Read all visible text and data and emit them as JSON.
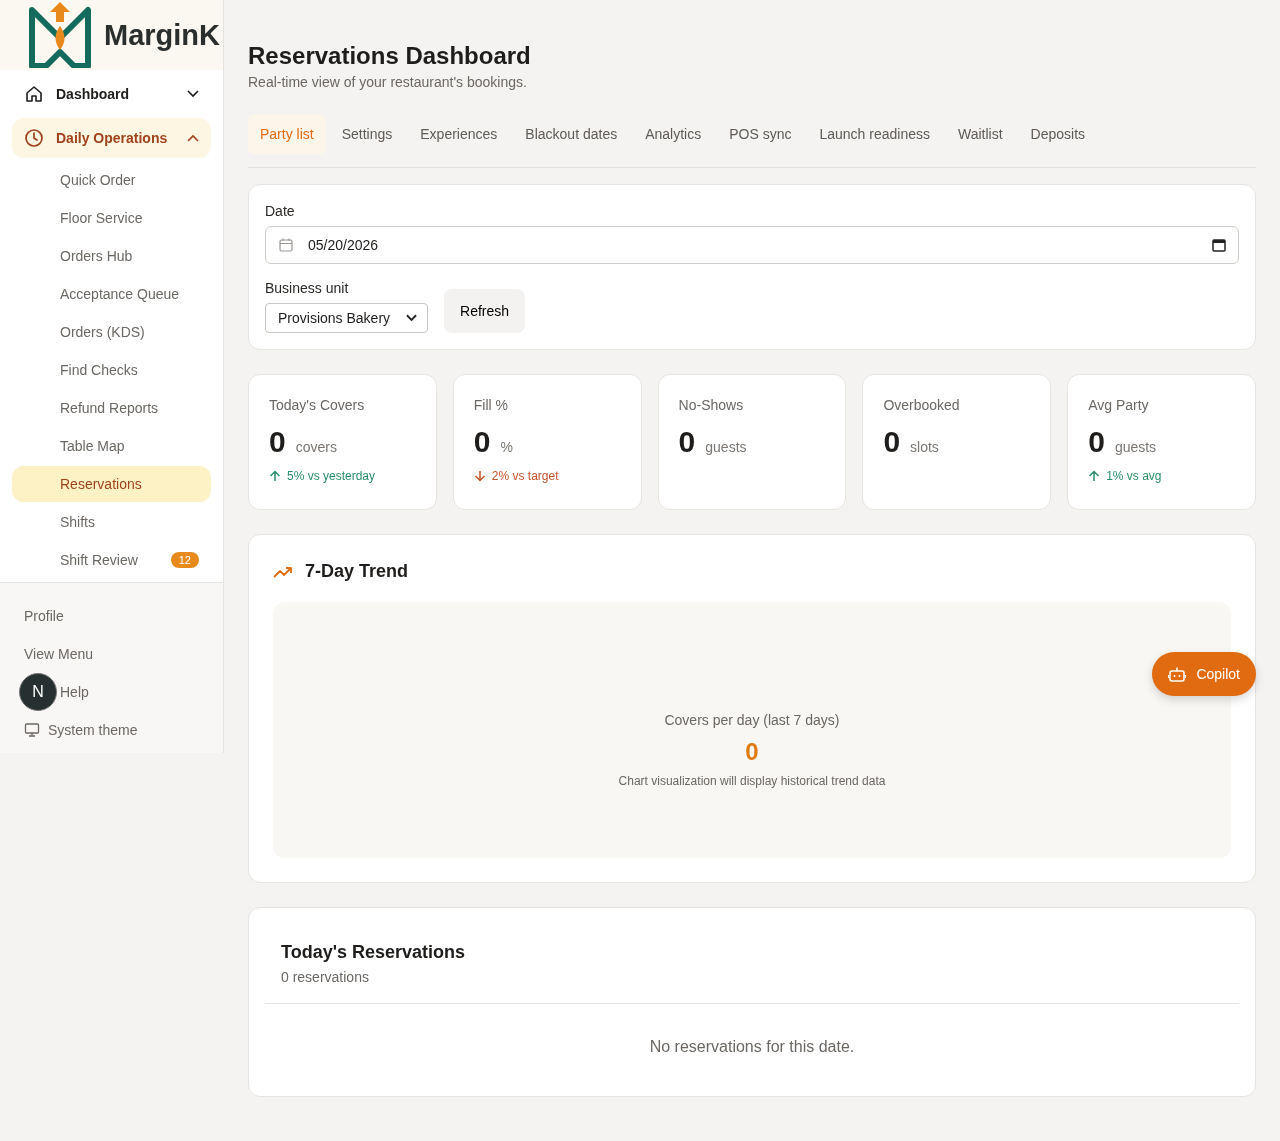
{
  "brand": {
    "name": "MarginK"
  },
  "sidebar": {
    "items": [
      {
        "label": "Dashboard",
        "expanded": false,
        "selected": false
      },
      {
        "label": "Daily Operations",
        "expanded": true,
        "selected": true,
        "children": [
          {
            "label": "Quick Order",
            "selected": false
          },
          {
            "label": "Floor Service",
            "selected": false
          },
          {
            "label": "Orders Hub",
            "selected": false
          },
          {
            "label": "Acceptance Queue",
            "selected": false
          },
          {
            "label": "Orders (KDS)",
            "selected": false
          },
          {
            "label": "Find Checks",
            "selected": false
          },
          {
            "label": "Refund Reports",
            "selected": false
          },
          {
            "label": "Table Map",
            "selected": false
          },
          {
            "label": "Reservations",
            "selected": true
          },
          {
            "label": "Shifts",
            "selected": false
          },
          {
            "label": "Shift Review",
            "selected": false,
            "badge": "12"
          }
        ]
      }
    ],
    "footer": [
      {
        "label": "Profile",
        "kind": "text"
      },
      {
        "label": "View Menu",
        "kind": "text"
      },
      {
        "label": "Help",
        "kind": "avatar",
        "avatar": "N"
      },
      {
        "label": "System theme",
        "kind": "theme"
      }
    ]
  },
  "page": {
    "title": "Reservations Dashboard",
    "subtitle": "Real-time view of your restaurant's bookings."
  },
  "tabs": [
    {
      "label": "Party list",
      "selected": true
    },
    {
      "label": "Settings",
      "selected": false
    },
    {
      "label": "Experiences",
      "selected": false
    },
    {
      "label": "Blackout dates",
      "selected": false
    },
    {
      "label": "Analytics",
      "selected": false
    },
    {
      "label": "POS sync",
      "selected": false
    },
    {
      "label": "Launch readiness",
      "selected": false
    },
    {
      "label": "Waitlist",
      "selected": false
    },
    {
      "label": "Deposits",
      "selected": false
    }
  ],
  "filters": {
    "date_label": "Date",
    "date_value": "05/20/2026",
    "unit_label": "Business unit",
    "unit_value": "Provisions Bakery",
    "refresh": "Refresh"
  },
  "stats": [
    {
      "title": "Today's Covers",
      "value": "0",
      "unit": "covers",
      "kind": "rise",
      "change": "5% vs yesterday"
    },
    {
      "title": "Fill %",
      "value": "0",
      "unit": "%",
      "kind": "fall",
      "change": "2% vs target"
    },
    {
      "title": "No-Shows",
      "value": "0",
      "unit": "guests",
      "kind": "plain"
    },
    {
      "title": "Overbooked",
      "value": "0",
      "unit": "slots",
      "kind": "plain"
    },
    {
      "title": "Avg Party",
      "value": "0",
      "unit": "guests",
      "kind": "rise",
      "change": "1% vs avg"
    }
  ],
  "trend": {
    "title": "7-Day Trend",
    "caption": "Covers per day (last 7 days)",
    "value": "0",
    "note": "Chart visualization will display historical trend data"
  },
  "reservations": {
    "title": "Today's Reservations",
    "count": "0 reservations",
    "empty": "No reservations for this date."
  },
  "copilot": {
    "label": "Copilot"
  }
}
